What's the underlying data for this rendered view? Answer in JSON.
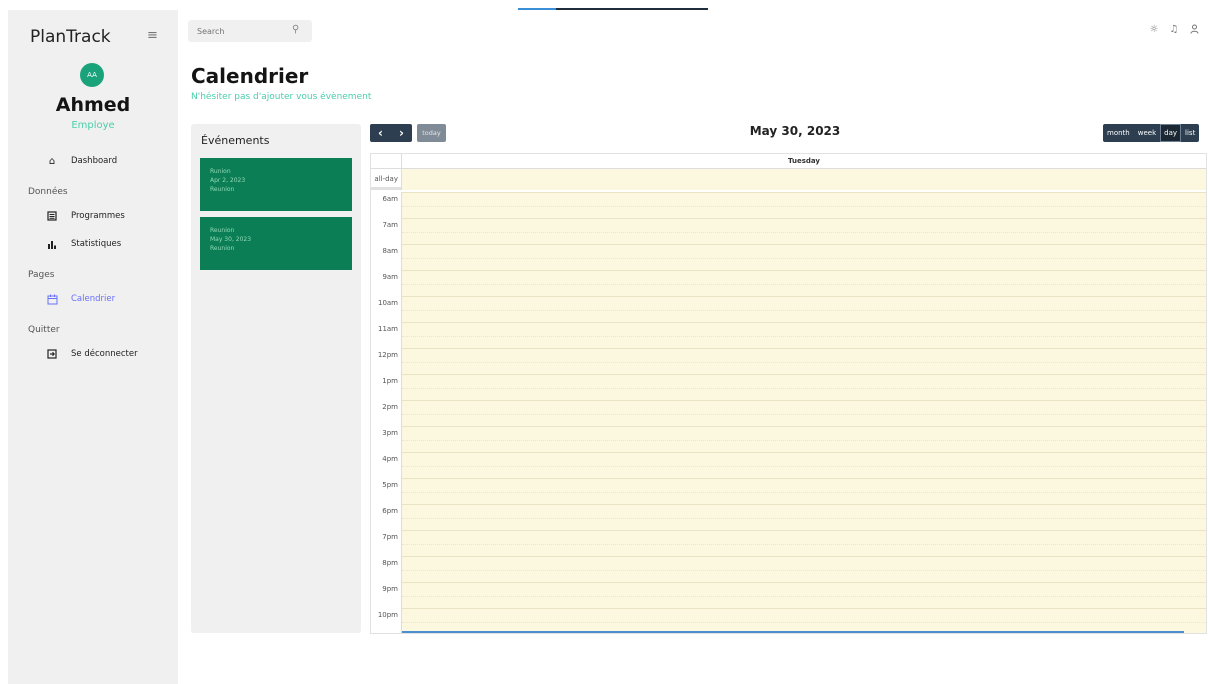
{
  "app": {
    "name": "PlanTrack"
  },
  "search": {
    "placeholder": "Search"
  },
  "user": {
    "initials": "AA",
    "name": "Ahmed",
    "role": "Employe"
  },
  "nav": {
    "dashboard": "Dashboard",
    "section_data": "Données",
    "programmes": "Programmes",
    "statistiques": "Statistiques",
    "section_pages": "Pages",
    "calendrier": "Calendrier",
    "section_quit": "Quitter",
    "logout": "Se déconnecter"
  },
  "header": {
    "title": "Calendrier",
    "subtitle": "N'hésiter pas d'ajouter vous évènement"
  },
  "events_panel": {
    "title": "Événements",
    "events": [
      {
        "title": "Runion",
        "date": "Apr 2, 2023",
        "desc": "Reunion"
      },
      {
        "title": "Reunion",
        "date": "May 30, 2023",
        "desc": "Reunion"
      }
    ]
  },
  "calendar": {
    "prev": "‹",
    "next": "›",
    "today": "today",
    "title": "May 30, 2023",
    "views": [
      "month",
      "week",
      "day",
      "list"
    ],
    "active_view": "day",
    "day_name": "Tuesday",
    "allday_label": "all-day",
    "time_slots": [
      "6am",
      "7am",
      "8am",
      "9am",
      "10am",
      "11am",
      "12pm",
      "1pm",
      "2pm",
      "3pm",
      "4pm",
      "5pm",
      "6pm",
      "7pm",
      "8pm",
      "9pm",
      "10pm"
    ]
  },
  "colors": {
    "accent_green": "#4cceac",
    "event_bg": "#0c7e55",
    "nav_active": "#6870fa",
    "calendar_toolbar": "#2c3e50",
    "day_bg": "#fcf7df"
  },
  "icons": {
    "menu": "menu-icon",
    "search": "search-icon",
    "theme": "sun-icon",
    "notifications": "bell-icon",
    "profile": "user-icon",
    "dashboard": "home-icon",
    "programmes": "list-icon",
    "statistiques": "bar-chart-icon",
    "calendrier": "calendar-icon",
    "logout": "logout-icon"
  }
}
